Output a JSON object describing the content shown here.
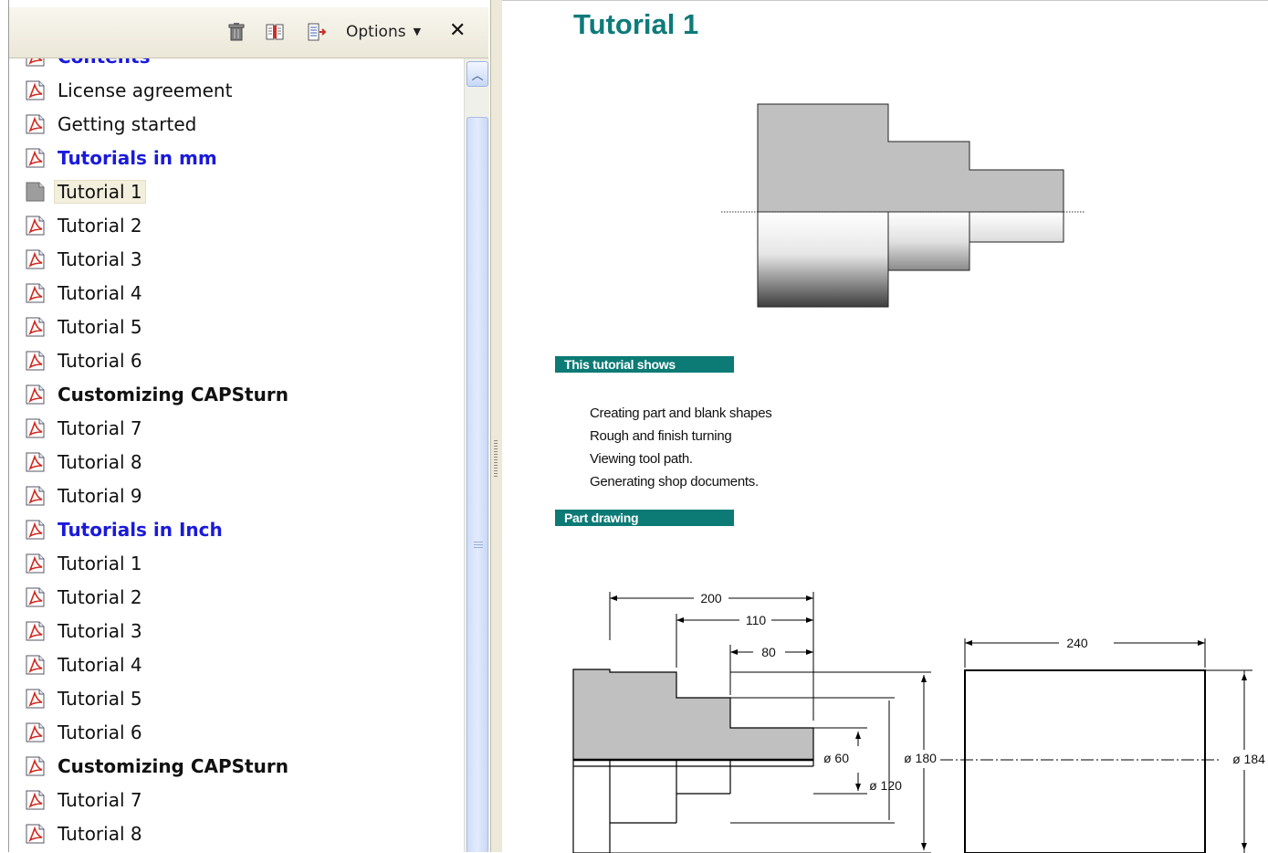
{
  "toolbar": {
    "options_label": "Options",
    "close_label": "✕",
    "icons": [
      "trash-icon",
      "expand-bookmark-icon",
      "new-bookmark-icon"
    ]
  },
  "bookmarks": [
    {
      "label": "Contents",
      "style": "blue",
      "partial": true
    },
    {
      "label": "License agreement",
      "style": "normal"
    },
    {
      "label": "Getting started",
      "style": "normal"
    },
    {
      "label": "Tutorials in mm",
      "style": "blue"
    },
    {
      "label": "Tutorial 1",
      "style": "selected"
    },
    {
      "label": "Tutorial 2",
      "style": "normal"
    },
    {
      "label": "Tutorial 3",
      "style": "normal"
    },
    {
      "label": "Tutorial 4",
      "style": "normal"
    },
    {
      "label": "Tutorial 5",
      "style": "normal"
    },
    {
      "label": "Tutorial 6",
      "style": "normal"
    },
    {
      "label": "Customizing CAPSturn",
      "style": "bold"
    },
    {
      "label": "Tutorial 7",
      "style": "normal"
    },
    {
      "label": "Tutorial 8",
      "style": "normal"
    },
    {
      "label": "Tutorial 9",
      "style": "normal"
    },
    {
      "label": "Tutorials in Inch",
      "style": "blue"
    },
    {
      "label": "Tutorial 1",
      "style": "normal"
    },
    {
      "label": "Tutorial 2",
      "style": "normal"
    },
    {
      "label": "Tutorial 3",
      "style": "normal"
    },
    {
      "label": "Tutorial 4",
      "style": "normal"
    },
    {
      "label": "Tutorial 5",
      "style": "normal"
    },
    {
      "label": "Tutorial 6",
      "style": "normal"
    },
    {
      "label": "Customizing CAPSturn",
      "style": "bold"
    },
    {
      "label": "Tutorial 7",
      "style": "normal"
    },
    {
      "label": "Tutorial 8",
      "style": "normal"
    }
  ],
  "document": {
    "title": "Tutorial 1",
    "section_shows": "This tutorial shows",
    "bullets": [
      "Creating part and blank shapes",
      "Rough and finish turning",
      "Viewing tool path.",
      "Generating shop documents."
    ],
    "section_drawing": "Part drawing",
    "dims": {
      "len_200": "200",
      "len_110": "110",
      "len_80": "80",
      "len_240": "240",
      "dia_60": "ø 60",
      "dia_120": "ø 120",
      "dia_180": "ø 180",
      "dia_184": "ø 184"
    }
  },
  "colors": {
    "accent_teal": "#0c7a75",
    "title_teal": "#0f7a7a",
    "bookmark_blue": "#1a1adb"
  }
}
